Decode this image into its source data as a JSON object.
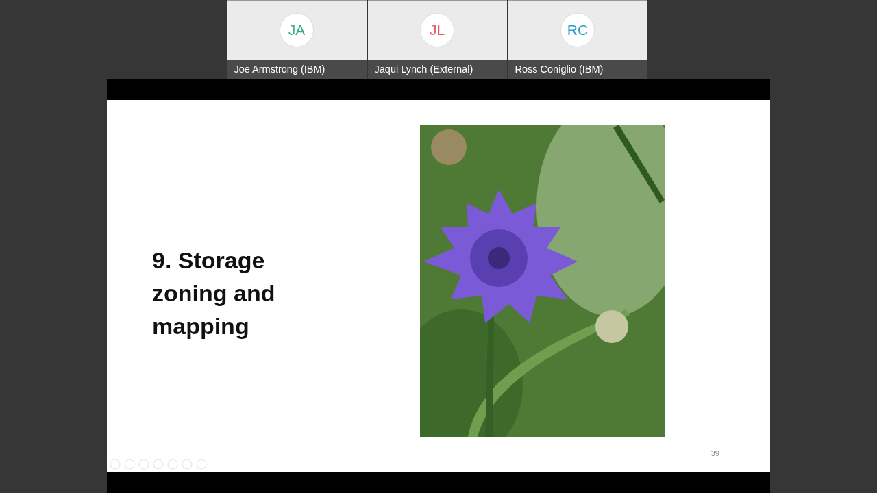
{
  "participants": [
    {
      "initials": "JA",
      "name": "Joe Armstrong (IBM)",
      "color": "#3fa88c"
    },
    {
      "initials": "JL",
      "name": "Jaqui Lynch (External)",
      "color": "#e0606a"
    },
    {
      "initials": "RC",
      "name": "Ross Coniglio (IBM)",
      "color": "#2f9ccf"
    }
  ],
  "slide": {
    "title": "9. Storage zoning and mapping",
    "picture": {
      "kind": "plant"
    },
    "page_number": "39"
  }
}
